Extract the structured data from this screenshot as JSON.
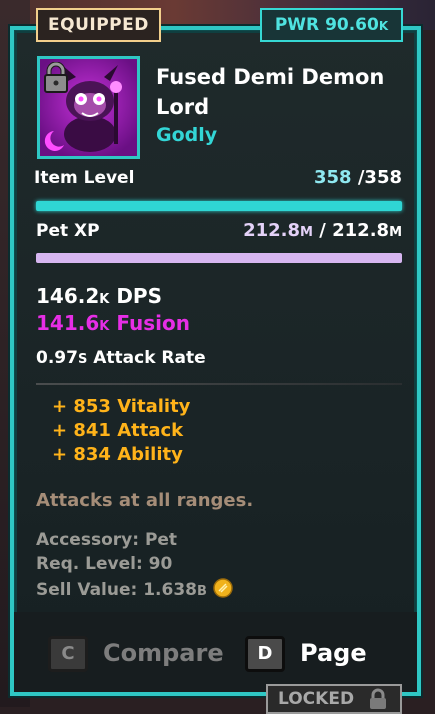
{
  "tags": {
    "equipped": "EQUIPPED",
    "power_label": "PWR 90.60",
    "power_unit": "K",
    "locked": "LOCKED"
  },
  "item": {
    "name": "Fused Demi Demon Lord",
    "rarity": "Godly",
    "portrait_icon": "demon-lord-pet-portrait",
    "lock_icon": "padlock-icon"
  },
  "item_level": {
    "label": "Item Level",
    "current": "358",
    "separator": "/",
    "max": "358",
    "progress": 1.0,
    "bar_color": "#2fd6d4"
  },
  "pet_xp": {
    "label": "Pet XP",
    "current": "212.8",
    "current_unit": "M",
    "separator": "/",
    "max": "212.8",
    "max_unit": "M",
    "progress": 1.0,
    "bar_color": "#d6b6f0"
  },
  "stats": {
    "dps_value": "146.2",
    "dps_unit": "K",
    "dps_label": "DPS",
    "fusion_value": "141.6",
    "fusion_unit": "K",
    "fusion_label": "Fusion",
    "fusion_icon": "crescent-moon-icon",
    "attack_rate_value": "0.97",
    "attack_rate_unit": "S",
    "attack_rate_label": "Attack Rate"
  },
  "bonuses": [
    {
      "text": "+ 853 Vitality"
    },
    {
      "text": "+ 841 Attack"
    },
    {
      "text": "+ 834 Ability"
    }
  ],
  "description": "Attacks at all ranges.",
  "meta": {
    "accessory": "Accessory: Pet",
    "req_level": "Req. Level: 90",
    "sell_value": "Sell Value: 1.638",
    "sell_unit": "B",
    "coin_icon": "gold-coin-icon"
  },
  "footer": {
    "compare_key": "C",
    "compare_label": "Compare",
    "page_key": "D",
    "page_label": "Page"
  },
  "colors": {
    "accent": "#2fc7c4",
    "godly": "#33d6d6",
    "fusion": "#e62ee6",
    "bonus": "#ffb31a",
    "item_level_current": "#8fe8f0",
    "pet_xp_current": "#e4d2f8"
  }
}
